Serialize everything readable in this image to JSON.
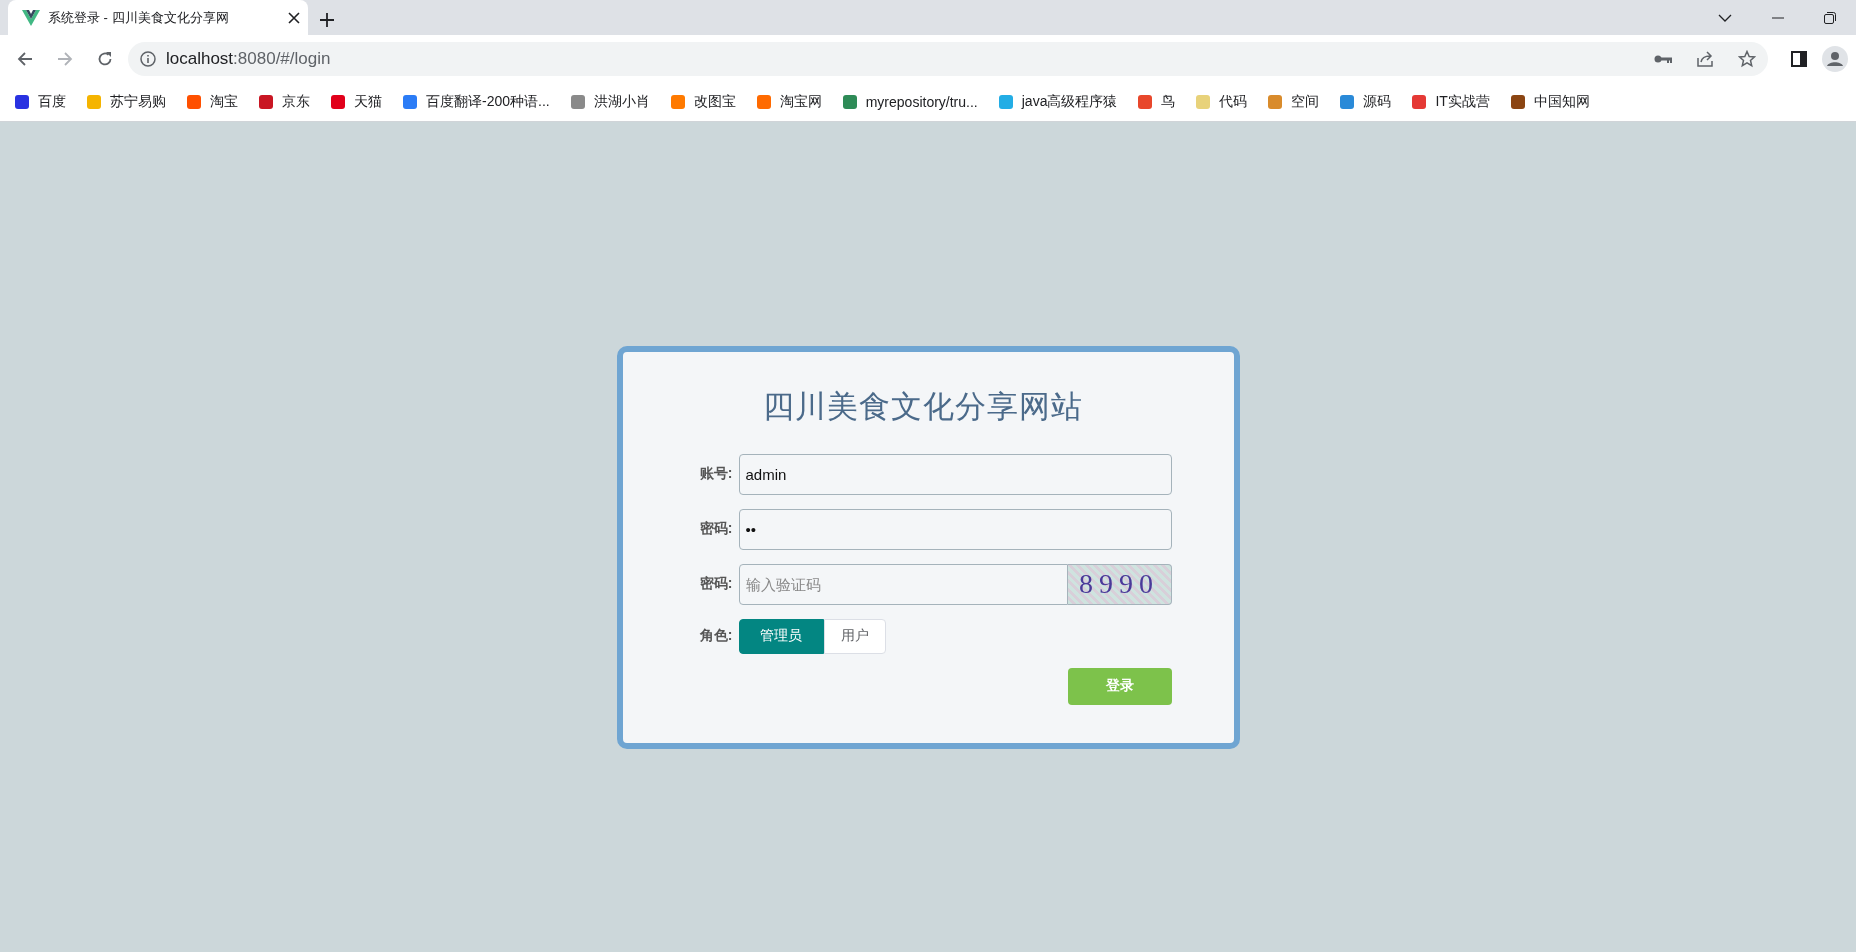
{
  "browser": {
    "tab": {
      "title": "系统登录 - 四川美食文化分享网"
    },
    "address": {
      "host": "localhost",
      "rest": ":8080/#/login"
    },
    "bookmarks": [
      {
        "label": "百度",
        "color": "#2932e1"
      },
      {
        "label": "苏宁易购",
        "color": "#f5b400"
      },
      {
        "label": "淘宝",
        "color": "#ff5000"
      },
      {
        "label": "京东",
        "color": "#c91623"
      },
      {
        "label": "天猫",
        "color": "#e1001a"
      },
      {
        "label": "百度翻译-200种语...",
        "color": "#2b7cf6"
      },
      {
        "label": "洪湖小肖",
        "color": "#8a8a8a"
      },
      {
        "label": "改图宝",
        "color": "#ff7a00"
      },
      {
        "label": "淘宝网",
        "color": "#ff6a00"
      },
      {
        "label": "myrepository/tru...",
        "color": "#2e8b57"
      },
      {
        "label": "java高级程序猿",
        "color": "#23ade5"
      },
      {
        "label": "鸟",
        "color": "#e8472b"
      },
      {
        "label": "代码",
        "color": "#e8d27a"
      },
      {
        "label": "空间",
        "color": "#d98b2b"
      },
      {
        "label": "源码",
        "color": "#2a8ad8"
      },
      {
        "label": "IT实战营",
        "color": "#e53935"
      },
      {
        "label": "中国知网",
        "color": "#8b4513"
      }
    ]
  },
  "login": {
    "title": "四川美食文化分享网站",
    "fields": [
      {
        "label": "账号:",
        "value": "admin"
      },
      {
        "label": "密码:",
        "value": "••"
      },
      {
        "label": "密码:",
        "placeholder": "输入验证码",
        "captcha": "8990"
      }
    ],
    "role": {
      "label": "角色:",
      "options": [
        {
          "label": "管理员",
          "selected": true
        },
        {
          "label": "用户",
          "selected": false
        }
      ]
    },
    "submit": "登录"
  }
}
